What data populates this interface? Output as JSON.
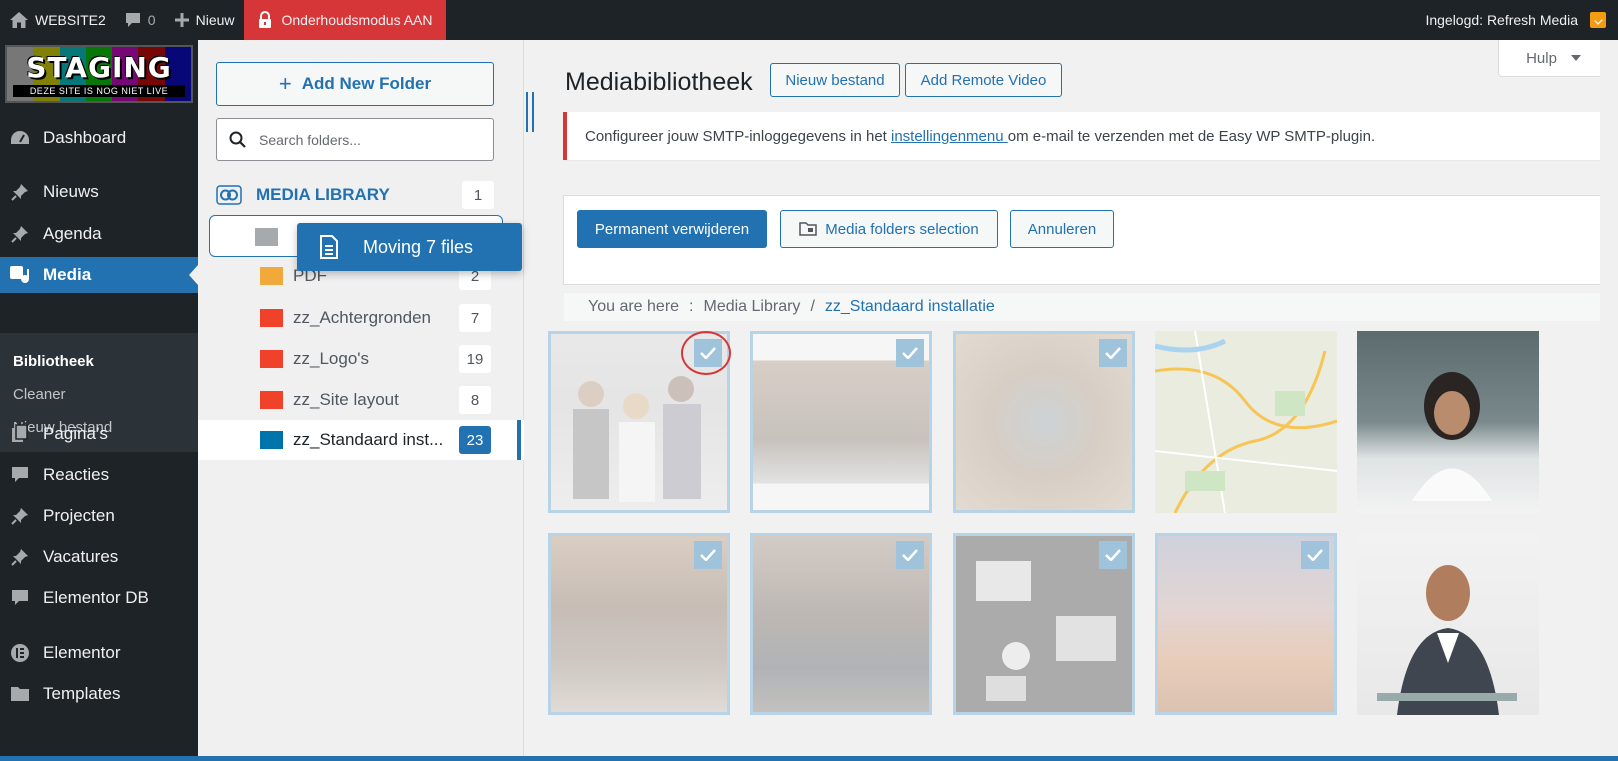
{
  "adminbar": {
    "site_name": "WEBSITE2",
    "comments_count": "0",
    "new_label": "Nieuw",
    "maintenance_label": "Onderhoudsmodus AAN",
    "logged_in": "Ingelogd: Refresh Media"
  },
  "staging_logo": {
    "title": "STAGING",
    "subtitle": "DEZE SITE IS NOG NIET LIVE"
  },
  "sidebar": {
    "items": [
      {
        "label": "Dashboard",
        "icon": "dashboard-icon"
      },
      {
        "label": "Nieuws",
        "icon": "pin-icon"
      },
      {
        "label": "Agenda",
        "icon": "pin-icon"
      },
      {
        "label": "Media",
        "icon": "media-icon"
      },
      {
        "label": "Pagina’s",
        "icon": "pages-icon"
      },
      {
        "label": "Reacties",
        "icon": "comment-icon"
      },
      {
        "label": "Projecten",
        "icon": "pin-icon"
      },
      {
        "label": "Vacatures",
        "icon": "pin-icon"
      },
      {
        "label": "Elementor DB",
        "icon": "comment-icon"
      },
      {
        "label": "Elementor",
        "icon": "elementor-icon"
      },
      {
        "label": "Templates",
        "icon": "folder-icon"
      }
    ],
    "submenu": [
      "Bibliotheek",
      "Cleaner",
      "Nieuw bestand"
    ]
  },
  "folders": {
    "add_button": "Add New Folder",
    "search_placeholder": "Search folders...",
    "library_label": "MEDIA LIBRARY",
    "library_count": "1",
    "list": [
      {
        "name": "PDF",
        "count": "2",
        "color": "#f0a93a"
      },
      {
        "name": "zz_Achtergronden",
        "count": "7",
        "color": "#f0412a"
      },
      {
        "name": "zz_Logo's",
        "count": "19",
        "color": "#f0412a"
      },
      {
        "name": "zz_Site layout",
        "count": "8",
        "color": "#f0412a"
      },
      {
        "name": "zz_Standaard inst...",
        "count": "23",
        "color": "#0073aa"
      }
    ],
    "drag_tooltip": "Moving 7 files"
  },
  "main": {
    "title": "Mediabibliotheek",
    "btn_new_file": "Nieuw bestand",
    "btn_remote_video": "Add Remote Video",
    "help": "Hulp",
    "notice_before": "Configureer jouw SMTP-inloggegevens in het ",
    "notice_link": "instellingenmenu ",
    "notice_after": "om e-mail te verzenden met de Easy WP SMTP-plugin.",
    "btn_delete": "Permanent verwijderen",
    "btn_media_folders": "Media folders selection",
    "btn_cancel": "Annuleren",
    "breadcrumb_prefix": "You are here",
    "breadcrumb_sep1": ":",
    "breadcrumb_root": "Media Library",
    "breadcrumb_sep2": "/",
    "breadcrumb_current": "zz_Standaard installatie"
  },
  "colors": {
    "accent": "#2271b1",
    "adminbar": "#1d2327",
    "danger": "#d63638"
  }
}
